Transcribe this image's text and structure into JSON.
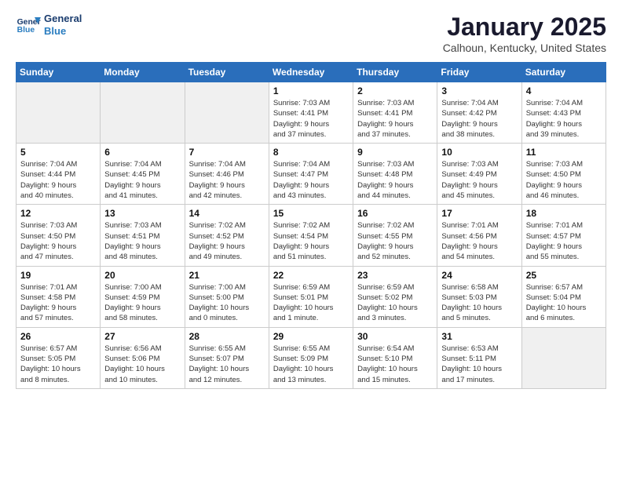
{
  "logo": {
    "line1": "General",
    "line2": "Blue"
  },
  "title": "January 2025",
  "location": "Calhoun, Kentucky, United States",
  "weekdays": [
    "Sunday",
    "Monday",
    "Tuesday",
    "Wednesday",
    "Thursday",
    "Friday",
    "Saturday"
  ],
  "weeks": [
    [
      {
        "day": "",
        "info": ""
      },
      {
        "day": "",
        "info": ""
      },
      {
        "day": "",
        "info": ""
      },
      {
        "day": "1",
        "info": "Sunrise: 7:03 AM\nSunset: 4:41 PM\nDaylight: 9 hours\nand 37 minutes."
      },
      {
        "day": "2",
        "info": "Sunrise: 7:03 AM\nSunset: 4:41 PM\nDaylight: 9 hours\nand 37 minutes."
      },
      {
        "day": "3",
        "info": "Sunrise: 7:04 AM\nSunset: 4:42 PM\nDaylight: 9 hours\nand 38 minutes."
      },
      {
        "day": "4",
        "info": "Sunrise: 7:04 AM\nSunset: 4:43 PM\nDaylight: 9 hours\nand 39 minutes."
      }
    ],
    [
      {
        "day": "5",
        "info": "Sunrise: 7:04 AM\nSunset: 4:44 PM\nDaylight: 9 hours\nand 40 minutes."
      },
      {
        "day": "6",
        "info": "Sunrise: 7:04 AM\nSunset: 4:45 PM\nDaylight: 9 hours\nand 41 minutes."
      },
      {
        "day": "7",
        "info": "Sunrise: 7:04 AM\nSunset: 4:46 PM\nDaylight: 9 hours\nand 42 minutes."
      },
      {
        "day": "8",
        "info": "Sunrise: 7:04 AM\nSunset: 4:47 PM\nDaylight: 9 hours\nand 43 minutes."
      },
      {
        "day": "9",
        "info": "Sunrise: 7:03 AM\nSunset: 4:48 PM\nDaylight: 9 hours\nand 44 minutes."
      },
      {
        "day": "10",
        "info": "Sunrise: 7:03 AM\nSunset: 4:49 PM\nDaylight: 9 hours\nand 45 minutes."
      },
      {
        "day": "11",
        "info": "Sunrise: 7:03 AM\nSunset: 4:50 PM\nDaylight: 9 hours\nand 46 minutes."
      }
    ],
    [
      {
        "day": "12",
        "info": "Sunrise: 7:03 AM\nSunset: 4:50 PM\nDaylight: 9 hours\nand 47 minutes."
      },
      {
        "day": "13",
        "info": "Sunrise: 7:03 AM\nSunset: 4:51 PM\nDaylight: 9 hours\nand 48 minutes."
      },
      {
        "day": "14",
        "info": "Sunrise: 7:02 AM\nSunset: 4:52 PM\nDaylight: 9 hours\nand 49 minutes."
      },
      {
        "day": "15",
        "info": "Sunrise: 7:02 AM\nSunset: 4:54 PM\nDaylight: 9 hours\nand 51 minutes."
      },
      {
        "day": "16",
        "info": "Sunrise: 7:02 AM\nSunset: 4:55 PM\nDaylight: 9 hours\nand 52 minutes."
      },
      {
        "day": "17",
        "info": "Sunrise: 7:01 AM\nSunset: 4:56 PM\nDaylight: 9 hours\nand 54 minutes."
      },
      {
        "day": "18",
        "info": "Sunrise: 7:01 AM\nSunset: 4:57 PM\nDaylight: 9 hours\nand 55 minutes."
      }
    ],
    [
      {
        "day": "19",
        "info": "Sunrise: 7:01 AM\nSunset: 4:58 PM\nDaylight: 9 hours\nand 57 minutes."
      },
      {
        "day": "20",
        "info": "Sunrise: 7:00 AM\nSunset: 4:59 PM\nDaylight: 9 hours\nand 58 minutes."
      },
      {
        "day": "21",
        "info": "Sunrise: 7:00 AM\nSunset: 5:00 PM\nDaylight: 10 hours\nand 0 minutes."
      },
      {
        "day": "22",
        "info": "Sunrise: 6:59 AM\nSunset: 5:01 PM\nDaylight: 10 hours\nand 1 minute."
      },
      {
        "day": "23",
        "info": "Sunrise: 6:59 AM\nSunset: 5:02 PM\nDaylight: 10 hours\nand 3 minutes."
      },
      {
        "day": "24",
        "info": "Sunrise: 6:58 AM\nSunset: 5:03 PM\nDaylight: 10 hours\nand 5 minutes."
      },
      {
        "day": "25",
        "info": "Sunrise: 6:57 AM\nSunset: 5:04 PM\nDaylight: 10 hours\nand 6 minutes."
      }
    ],
    [
      {
        "day": "26",
        "info": "Sunrise: 6:57 AM\nSunset: 5:05 PM\nDaylight: 10 hours\nand 8 minutes."
      },
      {
        "day": "27",
        "info": "Sunrise: 6:56 AM\nSunset: 5:06 PM\nDaylight: 10 hours\nand 10 minutes."
      },
      {
        "day": "28",
        "info": "Sunrise: 6:55 AM\nSunset: 5:07 PM\nDaylight: 10 hours\nand 12 minutes."
      },
      {
        "day": "29",
        "info": "Sunrise: 6:55 AM\nSunset: 5:09 PM\nDaylight: 10 hours\nand 13 minutes."
      },
      {
        "day": "30",
        "info": "Sunrise: 6:54 AM\nSunset: 5:10 PM\nDaylight: 10 hours\nand 15 minutes."
      },
      {
        "day": "31",
        "info": "Sunrise: 6:53 AM\nSunset: 5:11 PM\nDaylight: 10 hours\nand 17 minutes."
      },
      {
        "day": "",
        "info": ""
      }
    ]
  ]
}
